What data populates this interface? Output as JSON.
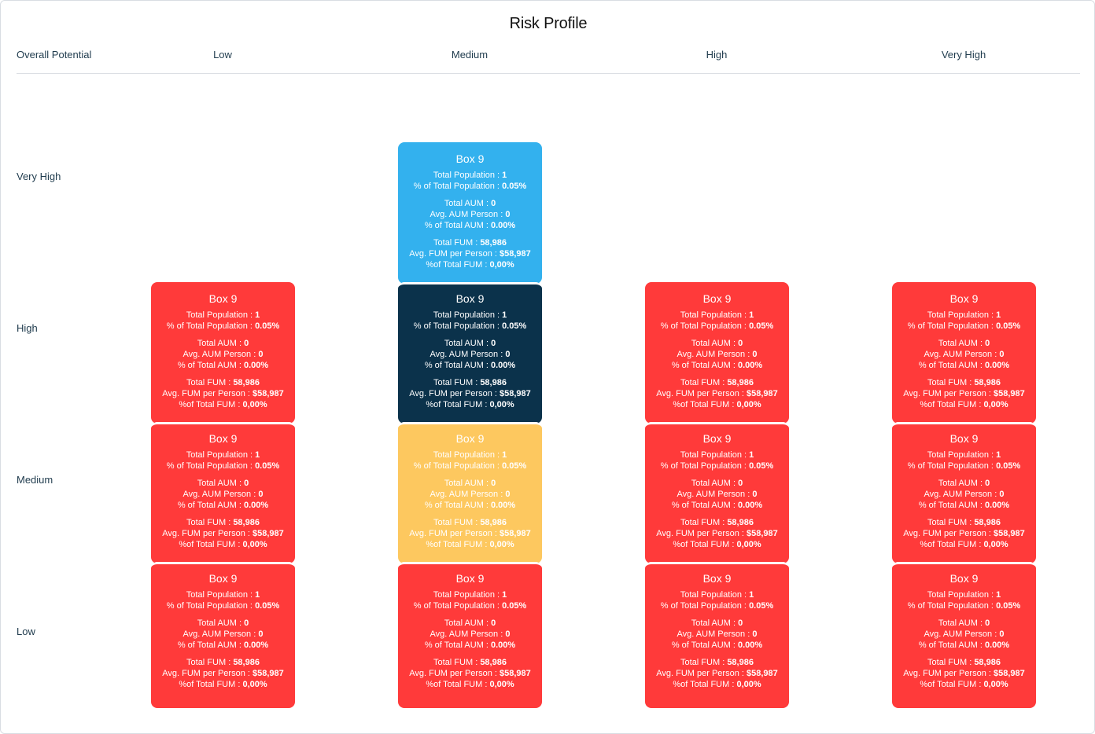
{
  "title": "Risk Profile",
  "columns": {
    "row_header": "Overall Potential",
    "low": "Low",
    "medium": "Medium",
    "high": "High",
    "very_high": "Very High"
  },
  "rows": {
    "very_high": "Very High",
    "high": "High",
    "medium": "Medium",
    "low": "Low"
  },
  "box": {
    "title": "Box 9",
    "total_population_label": "Total Population : ",
    "total_population": "1",
    "pct_total_population_label": "% of Total Population : ",
    "pct_total_population": "0.05%",
    "total_aum_label": "Total AUM : ",
    "total_aum": "0",
    "avg_aum_label": "Avg. AUM Person : ",
    "avg_aum": "0",
    "pct_total_aum_label": "% of Total AUM : ",
    "pct_total_aum": "0.00%",
    "total_fum_label": "Total FUM : ",
    "total_fum": "58,986",
    "avg_fum_label": "Avg. FUM per Person : ",
    "avg_fum": "$58,987",
    "pct_total_fum_label": "%of Total FUM : ",
    "pct_total_fum": "0,00%"
  },
  "colors": {
    "red": "#ff3a3a",
    "blue": "#33b1ee",
    "navy": "#0b324b",
    "yellow": "#fdc85f"
  }
}
